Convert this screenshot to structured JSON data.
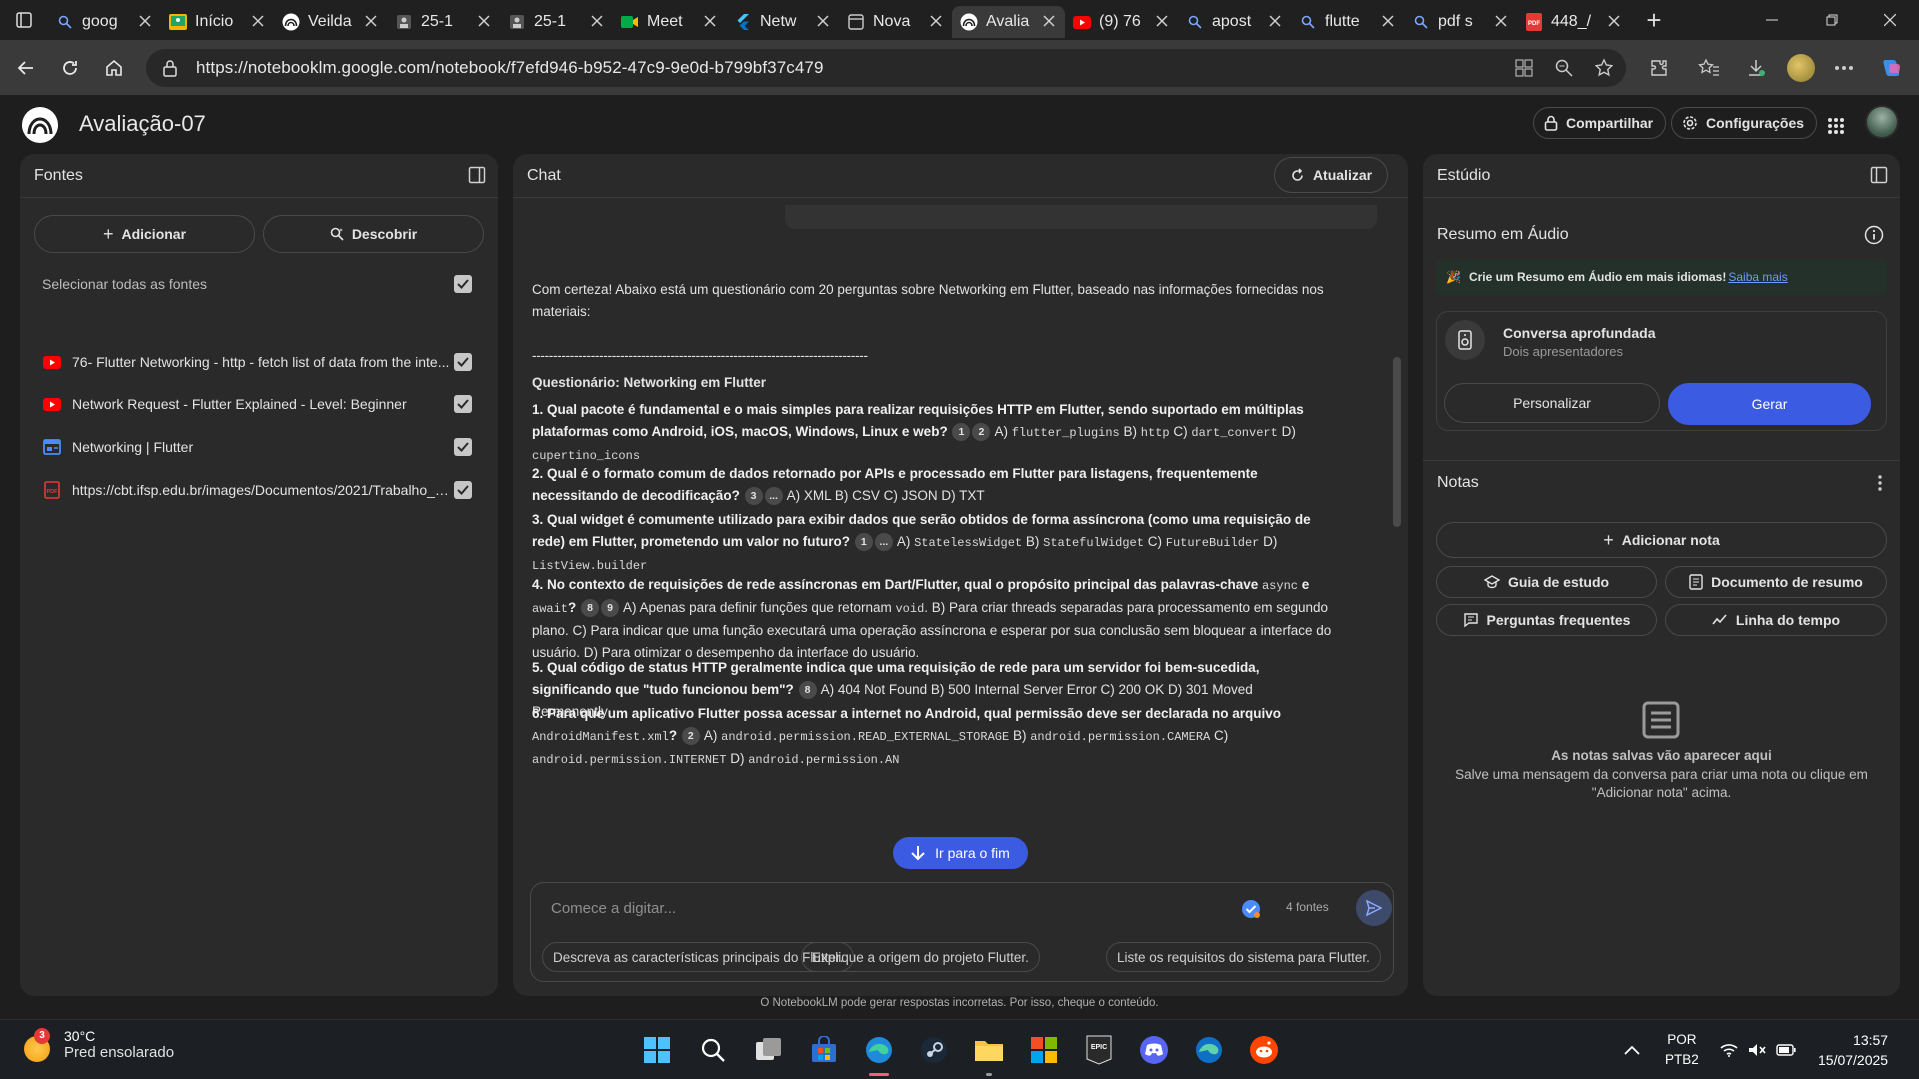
{
  "browser": {
    "tabs": [
      {
        "title": "goog",
        "icon": "search-icon",
        "color": "#7aa7ff"
      },
      {
        "title": "Início",
        "icon": "classroom-icon",
        "color": "#f4b400"
      },
      {
        "title": "Veilda",
        "icon": "notebooklm-icon",
        "color": "#ffffff"
      },
      {
        "title": "25-1",
        "icon": "document-icon",
        "color": "#cccccc"
      },
      {
        "title": "25-1",
        "icon": "document-icon",
        "color": "#cccccc"
      },
      {
        "title": "Meet",
        "icon": "meet-icon",
        "color": "#00ac47"
      },
      {
        "title": "Netw",
        "icon": "flutter-icon",
        "color": "#47c5fb"
      },
      {
        "title": "Nova",
        "icon": "newtab-icon",
        "color": "#cccccc"
      },
      {
        "title": "Avalia",
        "icon": "notebooklm-icon",
        "color": "#ffffff",
        "active": true
      },
      {
        "title": "(9) 76",
        "icon": "youtube-icon",
        "color": "#ff0000"
      },
      {
        "title": "apost",
        "icon": "search-icon",
        "color": "#7aa7ff"
      },
      {
        "title": "flutte",
        "icon": "search-icon",
        "color": "#7aa7ff"
      },
      {
        "title": "pdf s",
        "icon": "search-icon",
        "color": "#7aa7ff"
      },
      {
        "title": "448_/",
        "icon": "pdf-icon",
        "color": "#e53935"
      }
    ],
    "url": "https://notebooklm.google.com/notebook/f7efd946-b952-47c9-9e0d-b799bf37c479"
  },
  "header": {
    "title": "Avaliação-07",
    "share_label": "Compartilhar",
    "settings_label": "Configurações"
  },
  "fontes": {
    "title": "Fontes",
    "add_label": "Adicionar",
    "discover_label": "Descobrir",
    "select_all_label": "Selecionar todas as fontes",
    "items": [
      {
        "label": "76- Flutter Networking - http - fetch list of data from the inte...",
        "icon": "youtube-icon",
        "color": "#ff0000"
      },
      {
        "label": "Network Request - Flutter Explained - Level: Beginner",
        "icon": "youtube-icon",
        "color": "#ff0000"
      },
      {
        "label": "Networking | Flutter",
        "icon": "web-page-icon",
        "color": "#4a8cff"
      },
      {
        "label": "https://cbt.ifsp.edu.br/images/Documentos/2021/Trabalho_d...",
        "icon": "pdf-icon",
        "color": "#e53935"
      }
    ]
  },
  "chat": {
    "title": "Chat",
    "refresh_label": "Atualizar",
    "intro": "Com certeza! Abaixo está um questionário com 20 perguntas sobre Networking em Flutter, baseado nas informações fornecidas nos materiais:",
    "divider": "--------------------------------------------------------------------------------",
    "quiz_title": "Questionário: Networking em Flutter",
    "questions": [
      {
        "q": "1. Qual pacote é fundamental e o mais simples para realizar requisições HTTP em Flutter, sendo suportado em múltiplas plataformas como Android, iOS, macOS, Windows, Linux e web?",
        "cites": [
          "1",
          "2"
        ],
        "a": "A)",
        "a_code": "flutter_plugins",
        "b": "B)",
        "b_code": "http",
        "c": "C)",
        "c_code": "dart_convert",
        "d": "D)",
        "d_code": "cupertino_icons"
      },
      {
        "q": "2. Qual é o formato comum de dados retornado por APIs e processado em Flutter para listagens, frequentemente necessitando de decodificação?",
        "cites": [
          "3",
          "..."
        ],
        "answers": "A) XML B) CSV C) JSON D) TXT"
      },
      {
        "q": "3. Qual widget é comumente utilizado para exibir dados que serão obtidos de forma assíncrona (como uma requisição de rede) em Flutter, prometendo um valor no futuro?",
        "cites": [
          "1",
          "..."
        ],
        "a": "A)",
        "a_code": "StatelessWidget",
        "b": "B)",
        "b_code": "StatefulWidget",
        "c": "C)",
        "c_code": "FutureBuilder",
        "d": "D)",
        "d_code": "ListView.builder"
      },
      {
        "q_pre": "4. No contexto de requisições de rede assíncronas em Dart/Flutter, qual o propósito principal das palavras-chave",
        "q_code1": "async",
        "q_mid": "e",
        "q_code2": "await",
        "q_post": "?",
        "cites": [
          "8",
          "9"
        ],
        "a_pre": "A) Apenas para definir funções que retornam",
        "a_code": "void",
        "rest": ". B) Para criar threads separadas para processamento em segundo plano. C) Para indicar que uma função executará uma operação assíncrona e esperar por sua conclusão sem bloquear a interface do usuário. D) Para otimizar o desempenho da interface do usuário."
      },
      {
        "q": "5. Qual código de status HTTP geralmente indica que uma requisição de rede para um servidor foi bem-sucedida, significando que \"tudo funcionou bem\"?",
        "cites": [
          "8"
        ],
        "answers": "A) 404 Not Found B) 500 Internal Server Error C) 200 OK D) 301 Moved Permanently"
      },
      {
        "q": "6. Para que um aplicativo Flutter possa acessar a internet no Android, qual permissão deve ser declarada no arquivo",
        "q_code": "AndroidManifest.xml",
        "q_post": "?",
        "cites": [
          "2"
        ],
        "a": "A)",
        "a_code": "android.permission.READ_EXTERNAL_STORAGE",
        "b": "B)",
        "b_code": "android.permission.CAMERA",
        "c": "C)",
        "c_code": "android.permission.INTERNET",
        "d": "D)",
        "d_code": "android.permission.A",
        "d_tail": "N"
      }
    ],
    "jump_label": "Ir para o fim",
    "placeholder": "Comece a digitar...",
    "sources_count": "4 fontes",
    "suggestions": [
      "Descreva as características principais do Flutter.",
      "Explique a origem do projeto Flutter.",
      "Liste os requisitos do sistema para Flutter."
    ]
  },
  "estudio": {
    "title": "Estúdio",
    "audio_title": "Resumo em Áudio",
    "promo_text": "Crie um Resumo em Áudio em mais idiomas!",
    "promo_link": "Saiba mais",
    "deep_title": "Conversa aprofundada",
    "deep_sub": "Dois apresentadores",
    "customize_label": "Personalizar",
    "generate_label": "Gerar",
    "notes_title": "Notas",
    "add_note_label": "Adicionar nota",
    "study_guide": "Guia de estudo",
    "summary_doc": "Documento de resumo",
    "faq": "Perguntas frequentes",
    "timeline": "Linha do tempo",
    "empty_title": "As notas salvas vão aparecer aqui",
    "empty_body": "Salve uma mensagem da conversa para criar uma nota ou clique em \"Adicionar nota\" acima."
  },
  "footer_note": "O NotebookLM pode gerar respostas incorretas. Por isso, cheque o conteúdo.",
  "taskbar": {
    "temperature": "30°C",
    "weather": "Pred ensolarado",
    "weather_badge": "3",
    "lang1": "POR",
    "lang2": "PTB2",
    "time": "13:57",
    "date": "15/07/2025"
  },
  "colors": {
    "accent": "#3c5be3",
    "panel": "#2a2a2a",
    "background": "#1e1e1e"
  }
}
